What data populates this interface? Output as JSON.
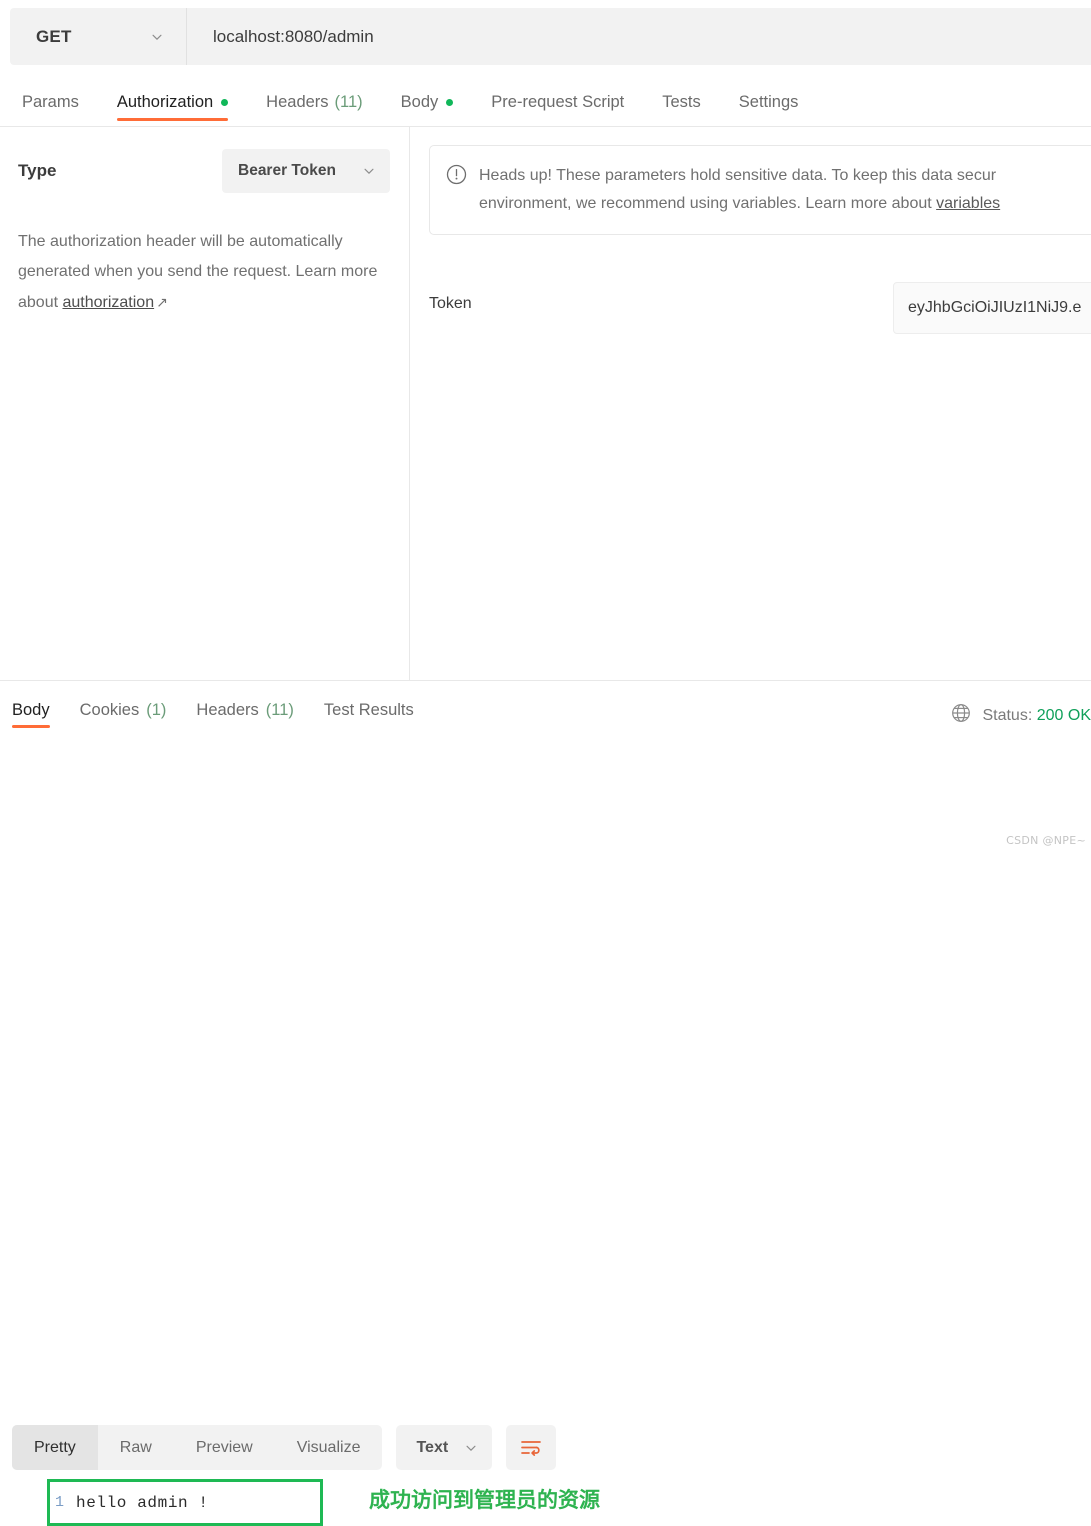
{
  "request_bar": {
    "method": "GET",
    "method_caret_icon": "chevron-down-icon",
    "url": "localhost:8080/admin"
  },
  "request_tabs": [
    {
      "label": "Params",
      "active": false,
      "dot": false,
      "count": ""
    },
    {
      "label": "Authorization",
      "active": true,
      "dot": true,
      "count": ""
    },
    {
      "label": "Headers",
      "active": false,
      "dot": false,
      "count": "(11)"
    },
    {
      "label": "Body",
      "active": false,
      "dot": true,
      "count": ""
    },
    {
      "label": "Pre-request Script",
      "active": false,
      "dot": false,
      "count": ""
    },
    {
      "label": "Tests",
      "active": false,
      "dot": false,
      "count": ""
    },
    {
      "label": "Settings",
      "active": false,
      "dot": false,
      "count": ""
    }
  ],
  "auth_panel": {
    "type_label": "Type",
    "type_value": "Bearer Token",
    "type_caret_icon": "chevron-down-icon",
    "description_part1": "The authorization header will be automatically generated when you send the request. Learn more about ",
    "description_link": "authorization",
    "description_arrow": "↗"
  },
  "warning": {
    "icon": "alert-circle-icon",
    "line1": "Heads up! These parameters hold sensitive data. To keep this data secur",
    "line2_prefix": "environment, we recommend using variables. Learn more about ",
    "line2_link": "variables"
  },
  "token": {
    "label": "Token",
    "value": "eyJhbGciOiJIUzI1NiJ9.e"
  },
  "response_tabs": [
    {
      "label": "Body",
      "active": true,
      "count": ""
    },
    {
      "label": "Cookies",
      "active": false,
      "count": "(1)"
    },
    {
      "label": "Headers",
      "active": false,
      "count": "(11)"
    },
    {
      "label": "Test Results",
      "active": false,
      "count": ""
    }
  ],
  "status": {
    "globe_icon": "globe-icon",
    "prefix": "Status:",
    "code": "200 OK"
  },
  "view_toolbar": {
    "segments": [
      {
        "label": "Pretty",
        "active": true
      },
      {
        "label": "Raw",
        "active": false
      },
      {
        "label": "Preview",
        "active": false
      },
      {
        "label": "Visualize",
        "active": false
      }
    ],
    "format_value": "Text",
    "format_caret_icon": "chevron-down-icon",
    "wrap_icon": "wrap-text-icon"
  },
  "response_body": {
    "line_number": "1",
    "content": "hello admin !"
  },
  "annotation": {
    "text": "成功访问到管理员的资源"
  },
  "watermark": {
    "text": "CSDN @NPE~"
  },
  "colors": {
    "accent_orange": "#ff6c37",
    "status_green": "#10a05a",
    "dot_green": "#10b759",
    "annotation_green": "#2eb350",
    "box_green": "#1eb954"
  }
}
